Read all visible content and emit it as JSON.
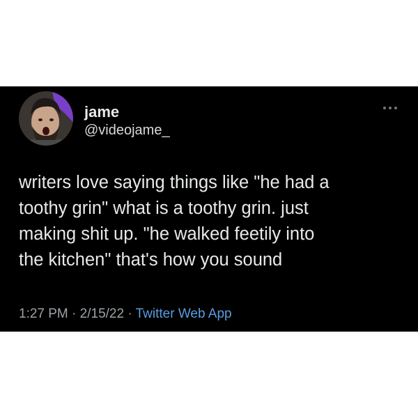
{
  "tweet": {
    "author": {
      "display_name": "jame",
      "handle": "@videojame_"
    },
    "more_icon": "more-horizontal-icon",
    "text_lines": [
      "writers love saying things like \"he had a",
      "toothy grin\" what is a toothy grin. just",
      "making shit up. \"he walked feetily into",
      "the kitchen\" that's how you sound"
    ],
    "time": "1:27 PM",
    "separator": "·",
    "date": "2/15/22",
    "source": "Twitter Web App"
  },
  "colors": {
    "card_background": "#000000",
    "page_background": "#ffffff",
    "text_primary": "#e7e9ea",
    "text_secondary": "#9ea3a7",
    "link": "#5a9de0",
    "avatar_accent": "#7a3fc8"
  }
}
